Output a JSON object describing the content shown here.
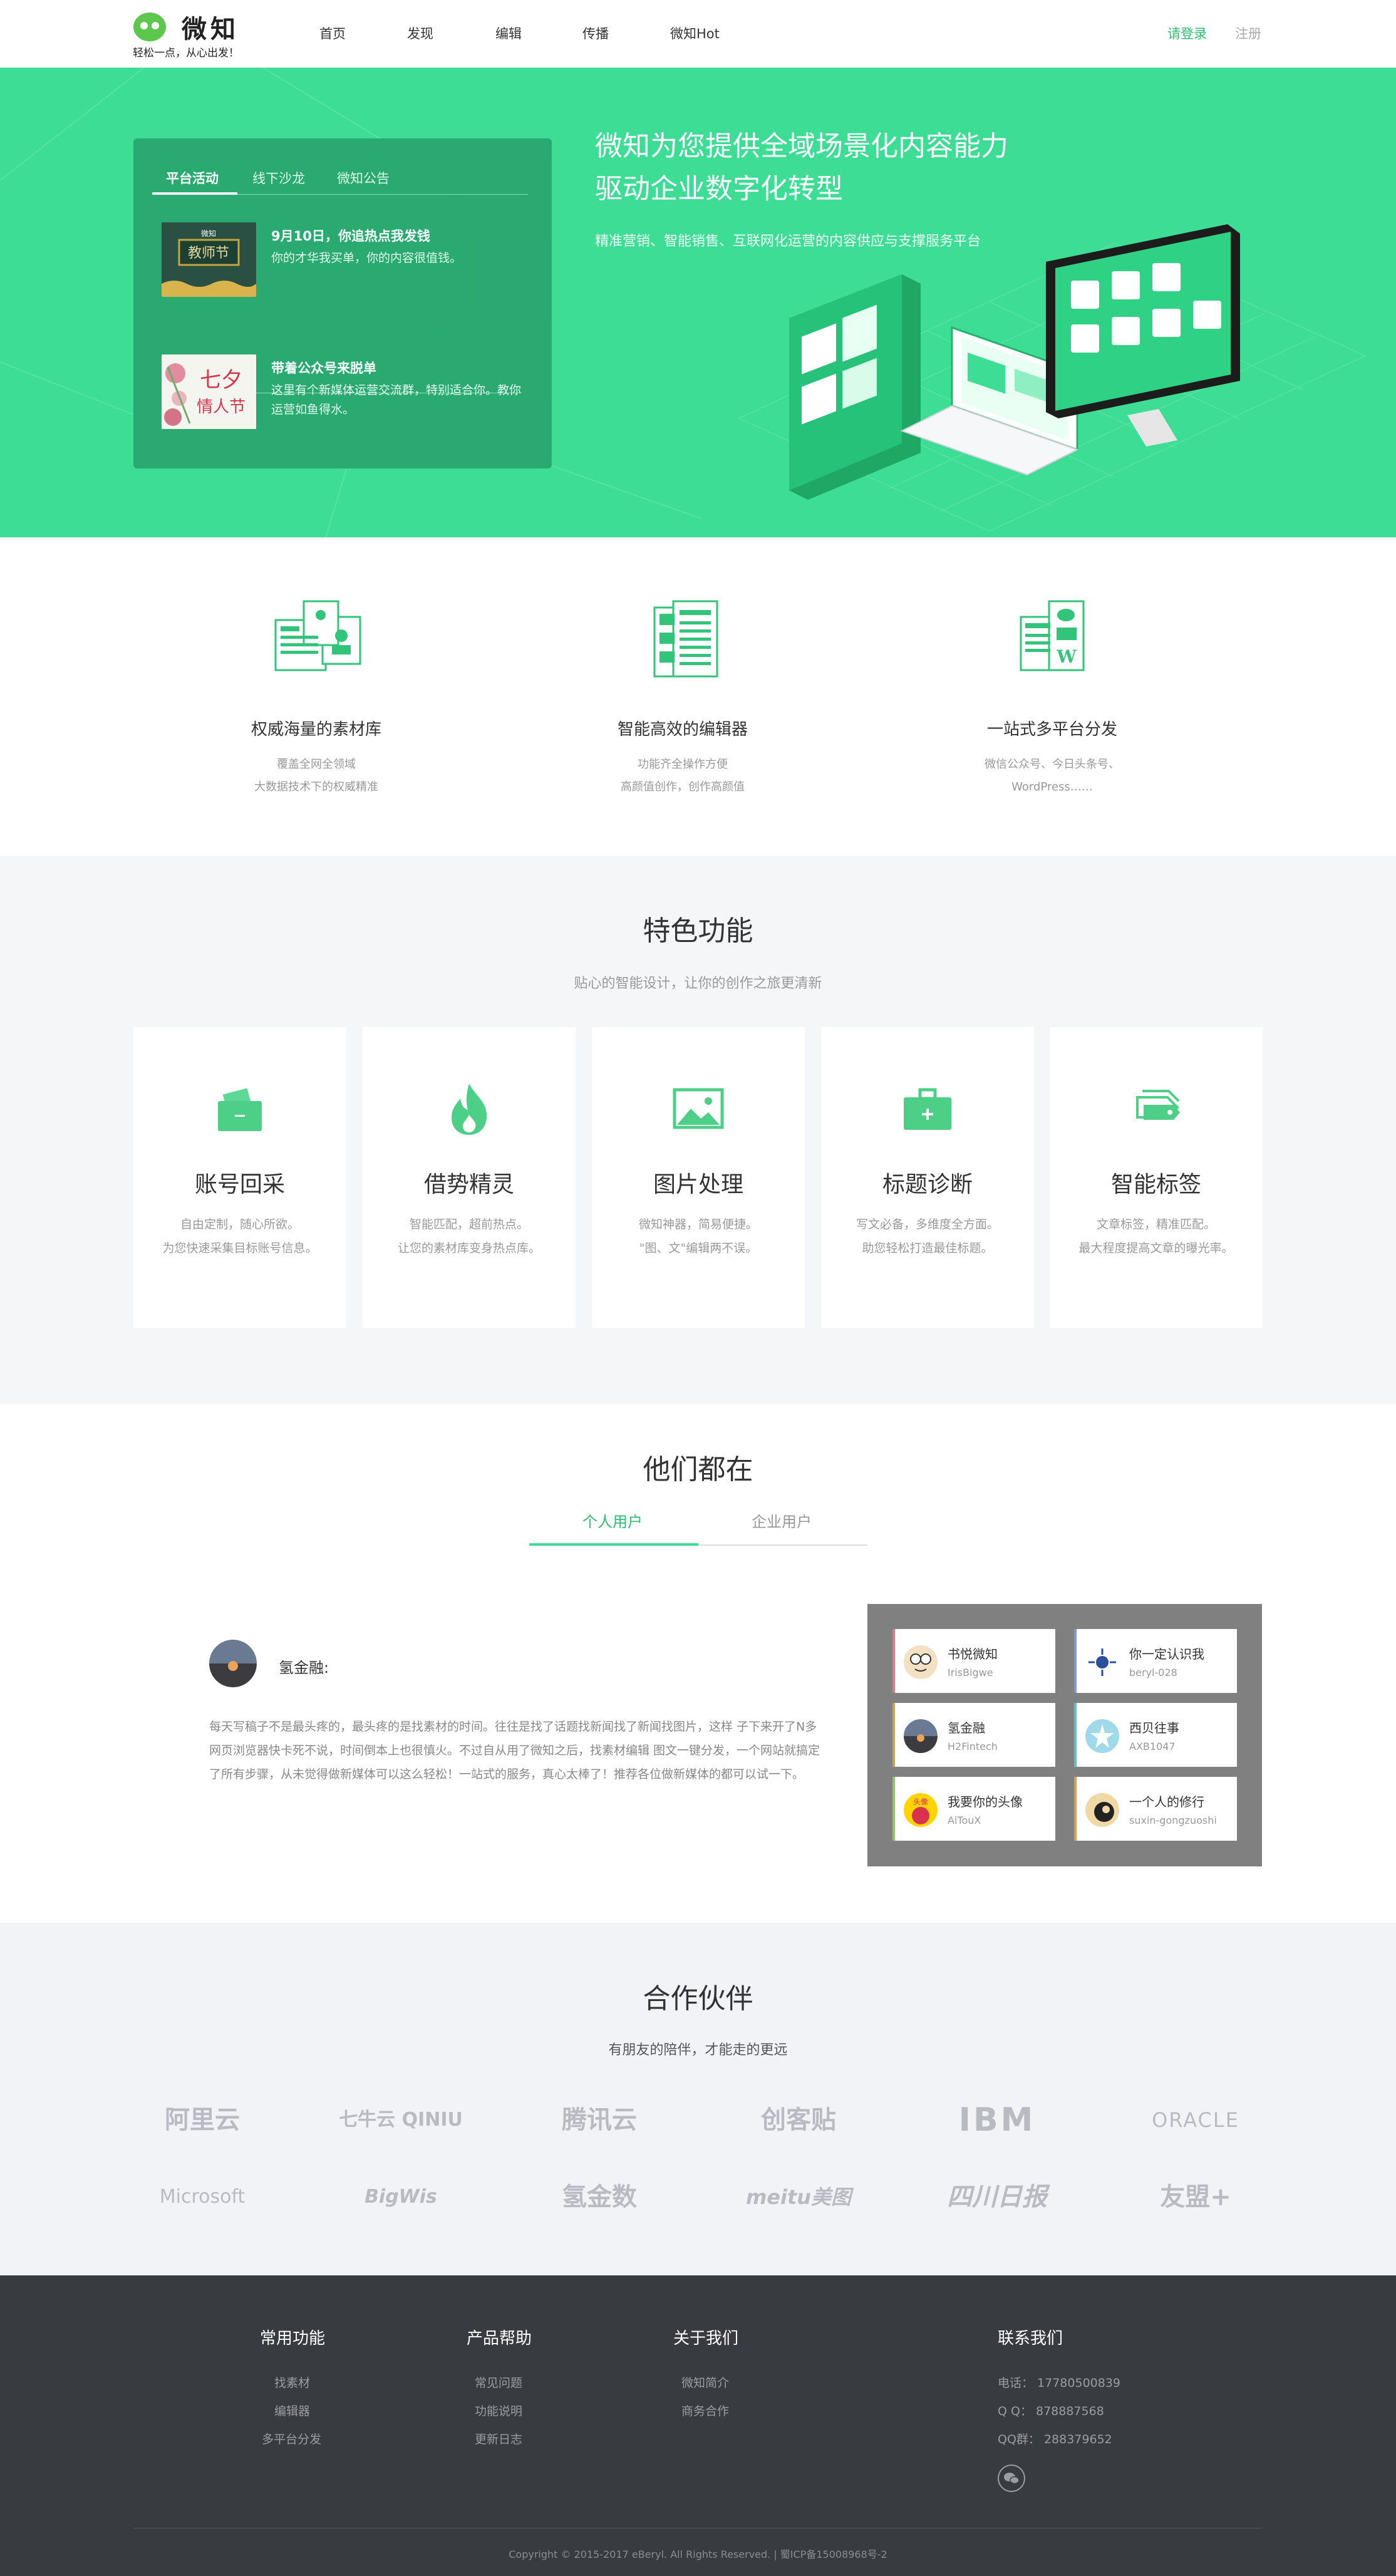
{
  "header": {
    "logo_name": "微知",
    "slogan": "轻松一点，从心出发！",
    "nav": [
      "首页",
      "发现",
      "编辑",
      "传播",
      "微知Hot"
    ],
    "login": "请登录",
    "register": "注册"
  },
  "hero": {
    "tabs": [
      "平台活动",
      "线下沙龙",
      "微知公告"
    ],
    "news": [
      {
        "title": "9月10日，你追热点我发钱",
        "desc": "你的才华我买单，你的内容很值钱。",
        "thumb_text": "微知 教师节"
      },
      {
        "title": "带着公众号来脱单",
        "desc": "这里有个新媒体运营交流群，特别适合你。教你运营如鱼得水。",
        "thumb_text": "七夕 情人节"
      }
    ],
    "title_line1": "微知为您提供全域场景化内容能力",
    "title_line2": "驱动企业数字化转型",
    "subtitle": "精准营销、智能销售、互联网化运营的内容供应与支撑服务平台"
  },
  "features": [
    {
      "title": "权威海量的素材库",
      "desc1": "覆盖全网全领域",
      "desc2": "大数据技术下的权威精准",
      "icon": "material-library-icon"
    },
    {
      "title": "智能高效的编辑器",
      "desc1": "功能齐全操作方便",
      "desc2": "高颜值创作，创作高颜值",
      "icon": "editor-icon"
    },
    {
      "title": "一站式多平台分发",
      "desc1": "微信公众号、今日头条号、",
      "desc2": "WordPress……",
      "icon": "distribution-icon"
    }
  ],
  "special": {
    "title": "特色功能",
    "subtitle": "贴心的智能设计，让你的创作之旅更清新",
    "cards": [
      {
        "title": "账号回采",
        "desc1": "自由定制，随心所欲。",
        "desc2": "为您快速采集目标账号信息。",
        "icon": "wallet-icon"
      },
      {
        "title": "借势精灵",
        "desc1": "智能匹配，超前热点。",
        "desc2": "让您的素材库变身热点库。",
        "icon": "flame-icon"
      },
      {
        "title": "图片处理",
        "desc1": "微知神器，简易便捷。",
        "desc2": "\"图、文\"编辑两不误。",
        "icon": "image-icon"
      },
      {
        "title": "标题诊断",
        "desc1": "写文必备，多维度全方面。",
        "desc2": "助您轻松打造最佳标题。",
        "icon": "medkit-icon"
      },
      {
        "title": "智能标签",
        "desc1": "文章标签，精准匹配。",
        "desc2": "最大程度提高文章的曝光率。",
        "icon": "tag-icon"
      }
    ]
  },
  "users": {
    "title": "他们都在",
    "tabs": [
      "个人用户",
      "企业用户"
    ],
    "featured_name": "氢金融:",
    "quote": "每天写稿子不是最头疼的，最头疼的是找素材的时间。往往是找了话题找新闻找了新闻找图片，这样 子下来开了N多网页浏览器快卡死不说，时间倒本上也很慎火。不过自从用了微知之后，找素材编辑 图文一键分发，一个网站就搞定了所有步骤，从未觉得做新媒体可以这么轻松！一站式的服务，真心太棒了！推荐各位做新媒体的都可以试一下。",
    "cards": [
      {
        "name": "书悦微知",
        "id": "IrisBigwe"
      },
      {
        "name": "你一定认识我",
        "id": "beryl-028"
      },
      {
        "name": "氢金融",
        "id": "H2Fintech"
      },
      {
        "name": "西贝往事",
        "id": "AXB1047"
      },
      {
        "name": "我要你的头像",
        "id": "AiTouX"
      },
      {
        "name": "一个人的修行",
        "id": "suxin-gongzuoshi"
      }
    ]
  },
  "partners": {
    "title": "合作伙伴",
    "subtitle": "有朋友的陪伴，才能走的更远",
    "logos": [
      "阿里云",
      "七牛云 QINIU",
      "腾讯云",
      "创客贴",
      "IBM",
      "ORACLE",
      "Microsoft",
      "BigWis",
      "氢金数",
      "meitu美图",
      "四川日报",
      "友盟+"
    ]
  },
  "footer": {
    "col1": {
      "title": "常用功能",
      "links": [
        "找素材",
        "编辑器",
        "多平台分发"
      ]
    },
    "col2": {
      "title": "产品帮助",
      "links": [
        "常见问题",
        "功能说明",
        "更新日志"
      ]
    },
    "col3": {
      "title": "关于我们",
      "links": [
        "微知简介",
        "商务合作"
      ]
    },
    "col4": {
      "title": "联系我们",
      "phone": "电话：  17780500839",
      "qq": "Q    Q：   878887568",
      "qq_group": "QQ群：   288379652"
    },
    "copyright": "Copyright © 2015-2017 eBeryl. All Rights Reserved.    |   蜀ICP备15008968号-2"
  },
  "colors": {
    "brand": "#3ddd95",
    "brand_dark": "#2aa770",
    "link_green": "#2fbe72",
    "footer_bg": "#383b3f"
  }
}
